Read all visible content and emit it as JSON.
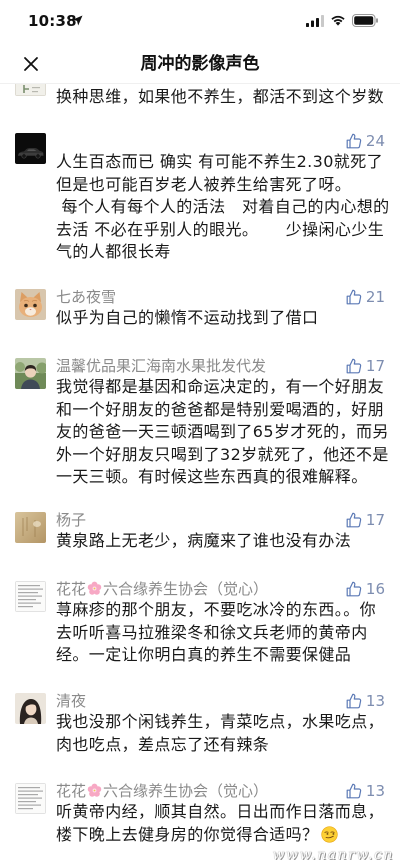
{
  "status_bar": {
    "time": "10:38",
    "icons": [
      "location-arrow-icon",
      "signal-icon",
      "wifi-icon",
      "battery-icon"
    ]
  },
  "nav": {
    "title": "周冲的影像声色",
    "close_icon": "close-icon"
  },
  "colors": {
    "text": "#191919",
    "name": "#8a8a8a",
    "like_icon": "#5b79b5",
    "like_count": "#7d8db0",
    "background": "#ffffff"
  },
  "comments": [
    {
      "lines": [
        "换种思维，如果他不养生，都活不到这个岁数"
      ]
    },
    {
      "likes": 24,
      "lines": [
        "人生百态而已 确实 有可能不养生2.30就死了",
        "但是也可能百岁老人被养生给害死了呀。",
        " 每个人有每个人的活法   对着自己的内心想的",
        "去活 不必在乎别人的眼光。     少操闲心少生",
        "气的人都很长寿"
      ]
    },
    {
      "name": "七あ夜雪",
      "likes": 21,
      "lines": [
        "似乎为自己的懒惰不运动找到了借口"
      ]
    },
    {
      "name": "温馨优品果汇海南水果批发代发",
      "likes": 17,
      "lines": [
        "我觉得都是基因和命运决定的，有一个好朋友",
        "和一个好朋友的爸爸都是特别爱喝酒的，好朋",
        "友的爸爸一天三顿酒喝到了65岁才死的，而另",
        "外一个好朋友只喝到了32岁就死了，他还不是",
        "一天三顿。有时候这些东西真的很难解释。"
      ]
    },
    {
      "name": "杨子",
      "likes": 17,
      "lines": [
        "黄泉路上无老少，病魔来了谁也没有办法"
      ]
    },
    {
      "name_before_emoji": "花花",
      "name_emoji_icon": "cherry-blossom-icon",
      "name_after_emoji": "六合缘养生协会（觉心）",
      "likes": 16,
      "lines": [
        "荨麻疹的那个朋友，不要吃冰冷的东西。。你",
        "去听听喜马拉雅梁冬和徐文兵老师的黄帝内",
        "经。一定让你明白真的养生不需要保健品"
      ]
    },
    {
      "name": "清夜",
      "likes": 13,
      "lines": [
        "我也没那个闲钱养生，青菜吃点，水果吃点，",
        "肉也吃点，差点忘了还有辣条"
      ]
    },
    {
      "name_before_emoji": "花花",
      "name_emoji_icon": "cherry-blossom-icon",
      "name_after_emoji": "六合缘养生协会（觉心）",
      "likes": 13,
      "lines": [
        "听黄帝内经，顺其自然。日出而作日落而息，",
        "楼下晚上去健身房的你觉得合适吗？"
      ],
      "trailing_emoji_icon": "smirking-face-icon"
    }
  ],
  "watermark": "www.nanrw.cn"
}
